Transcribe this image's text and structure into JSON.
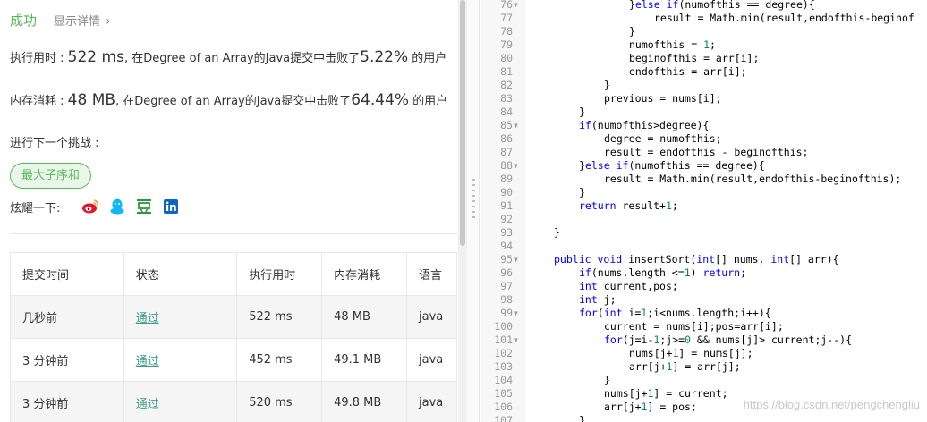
{
  "result": {
    "status": "成功",
    "details_link": "显示详情",
    "details_chevron": "›",
    "runtime_prefix": "执行用时 : ",
    "runtime_value": "522 ms",
    "runtime_mid": ", 在Degree of an Array的Java提交中击败了",
    "runtime_pct": "5.22%",
    "runtime_suffix": " 的用户",
    "memory_prefix": "内存消耗 : ",
    "memory_value": "48 MB",
    "memory_mid": ", 在Degree of an Array的Java提交中击败了",
    "memory_pct": "64.44%",
    "memory_suffix": " 的用户",
    "next_label": "进行下一个挑战 :",
    "next_tag": "最大子序和",
    "share_label": "炫耀一下:"
  },
  "share_icons": [
    "weibo-icon",
    "qq-icon",
    "douban-icon",
    "linkedin-icon"
  ],
  "submissions": {
    "headers": [
      "提交时间",
      "状态",
      "执行用时",
      "内存消耗",
      "语言"
    ],
    "rows": [
      [
        "几秒前",
        "通过",
        "522 ms",
        "48 MB",
        "java"
      ],
      [
        "3 分钟前",
        "通过",
        "452 ms",
        "49.1 MB",
        "java"
      ],
      [
        "3 分钟前",
        "通过",
        "520 ms",
        "49.8 MB",
        "java"
      ]
    ]
  },
  "colors": {
    "success": "#5cb85c",
    "pass_link": "#3f9b8d",
    "keyword": "#0000ff",
    "number": "#098658"
  },
  "editor": {
    "watermark": "https://blog.csdn.net/pengchengliu",
    "lines": [
      {
        "n": "76",
        "fold": true,
        "indent": 16,
        "text": "}else if(numofthis == degree){"
      },
      {
        "n": "77",
        "fold": false,
        "indent": 20,
        "text": "result = Math.min(result,endofthis-beginof"
      },
      {
        "n": "78",
        "fold": false,
        "indent": 16,
        "text": "}"
      },
      {
        "n": "79",
        "fold": false,
        "indent": 16,
        "text": "numofthis = 1;"
      },
      {
        "n": "80",
        "fold": false,
        "indent": 16,
        "text": "beginofthis = arr[i];"
      },
      {
        "n": "81",
        "fold": false,
        "indent": 16,
        "text": "endofthis = arr[i];"
      },
      {
        "n": "82",
        "fold": false,
        "indent": 12,
        "text": "}"
      },
      {
        "n": "83",
        "fold": false,
        "indent": 12,
        "text": "previous = nums[i];"
      },
      {
        "n": "84",
        "fold": false,
        "indent": 8,
        "text": "}"
      },
      {
        "n": "85",
        "fold": true,
        "indent": 8,
        "text": "if(numofthis>degree){"
      },
      {
        "n": "86",
        "fold": false,
        "indent": 12,
        "text": "degree = numofthis;"
      },
      {
        "n": "87",
        "fold": false,
        "indent": 12,
        "text": "result = endofthis - beginofthis;"
      },
      {
        "n": "88",
        "fold": true,
        "indent": 8,
        "text": "}else if(numofthis == degree){"
      },
      {
        "n": "89",
        "fold": false,
        "indent": 12,
        "text": "result = Math.min(result,endofthis-beginofthis);"
      },
      {
        "n": "90",
        "fold": false,
        "indent": 8,
        "text": "}"
      },
      {
        "n": "91",
        "fold": false,
        "indent": 8,
        "text": "return result+1;"
      },
      {
        "n": "92",
        "fold": false,
        "indent": 0,
        "text": ""
      },
      {
        "n": "93",
        "fold": false,
        "indent": 4,
        "text": "}"
      },
      {
        "n": "94",
        "fold": false,
        "indent": 0,
        "text": ""
      },
      {
        "n": "95",
        "fold": true,
        "indent": 4,
        "text": "public void insertSort(int[] nums, int[] arr){"
      },
      {
        "n": "96",
        "fold": false,
        "indent": 8,
        "text": "if(nums.length <=1) return;"
      },
      {
        "n": "97",
        "fold": false,
        "indent": 8,
        "text": "int current,pos;"
      },
      {
        "n": "98",
        "fold": false,
        "indent": 8,
        "text": "int j;"
      },
      {
        "n": "99",
        "fold": true,
        "indent": 8,
        "text": "for(int i=1;i<nums.length;i++){"
      },
      {
        "n": "100",
        "fold": false,
        "indent": 12,
        "text": "current = nums[i];pos=arr[i];"
      },
      {
        "n": "101",
        "fold": true,
        "indent": 12,
        "text": "for(j=i-1;j>=0 && nums[j]> current;j--){"
      },
      {
        "n": "102",
        "fold": false,
        "indent": 16,
        "text": "nums[j+1] = nums[j];"
      },
      {
        "n": "103",
        "fold": false,
        "indent": 16,
        "text": "arr[j+1] = arr[j];"
      },
      {
        "n": "104",
        "fold": false,
        "indent": 12,
        "text": "}"
      },
      {
        "n": "105",
        "fold": false,
        "indent": 12,
        "text": "nums[j+1] = current;"
      },
      {
        "n": "106",
        "fold": false,
        "indent": 12,
        "text": "arr[j+1] = pos;"
      },
      {
        "n": "107",
        "fold": false,
        "indent": 8,
        "text": "}"
      }
    ]
  }
}
